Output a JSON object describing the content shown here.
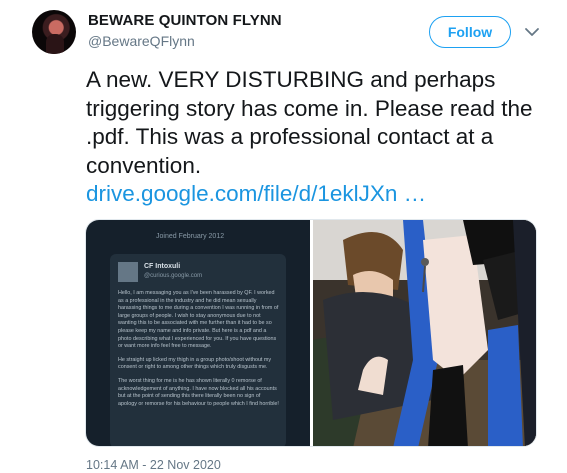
{
  "author": {
    "display_name": "BEWARE QUINTON FLYNN",
    "handle": "@BewareQFlynn"
  },
  "actions": {
    "follow_label": "Follow"
  },
  "tweet": {
    "text": "A new. VERY DISTURBING and perhaps triggering story has come in. Please read the .pdf. This was a professional contact at a convention.",
    "link": "drive.google.com/file/d/1eklJXn …",
    "timestamp": "10:14 AM - 22 Nov 2020"
  },
  "media": {
    "screenshot": {
      "joined": "Joined February 2012",
      "dm_name": "CF Intoxuli",
      "dm_sub": "@curious.google.com",
      "paragraphs": [
        "Hello, I am messaging you as I've been harassed by QF. I worked as a professional in the industry and he did mean sexually harassing things to me during a convention I was running in from of large groups of people. I wish to stay anonymous due to not wanting this to be associated with me further than it had to be so please keep my name and info private. But here is a pdf and a photo describing what I experienced for you. If you have questions or want more info feel free to message.",
        "He straight up licked my thigh in a group photo/shoot without my consent or right to among other things which truly disgusts me.",
        "The worst thing for me is he has shown literally 0 remorse of acknowledgement of anything. I have now blocked all his accounts but at the point of sending this there literally been no sign of apology or remorse for his behaviour to people which I find horrible!"
      ]
    }
  },
  "colors": {
    "accent": "#1da1f2",
    "link": "#1b95e0",
    "muted": "#657786"
  }
}
